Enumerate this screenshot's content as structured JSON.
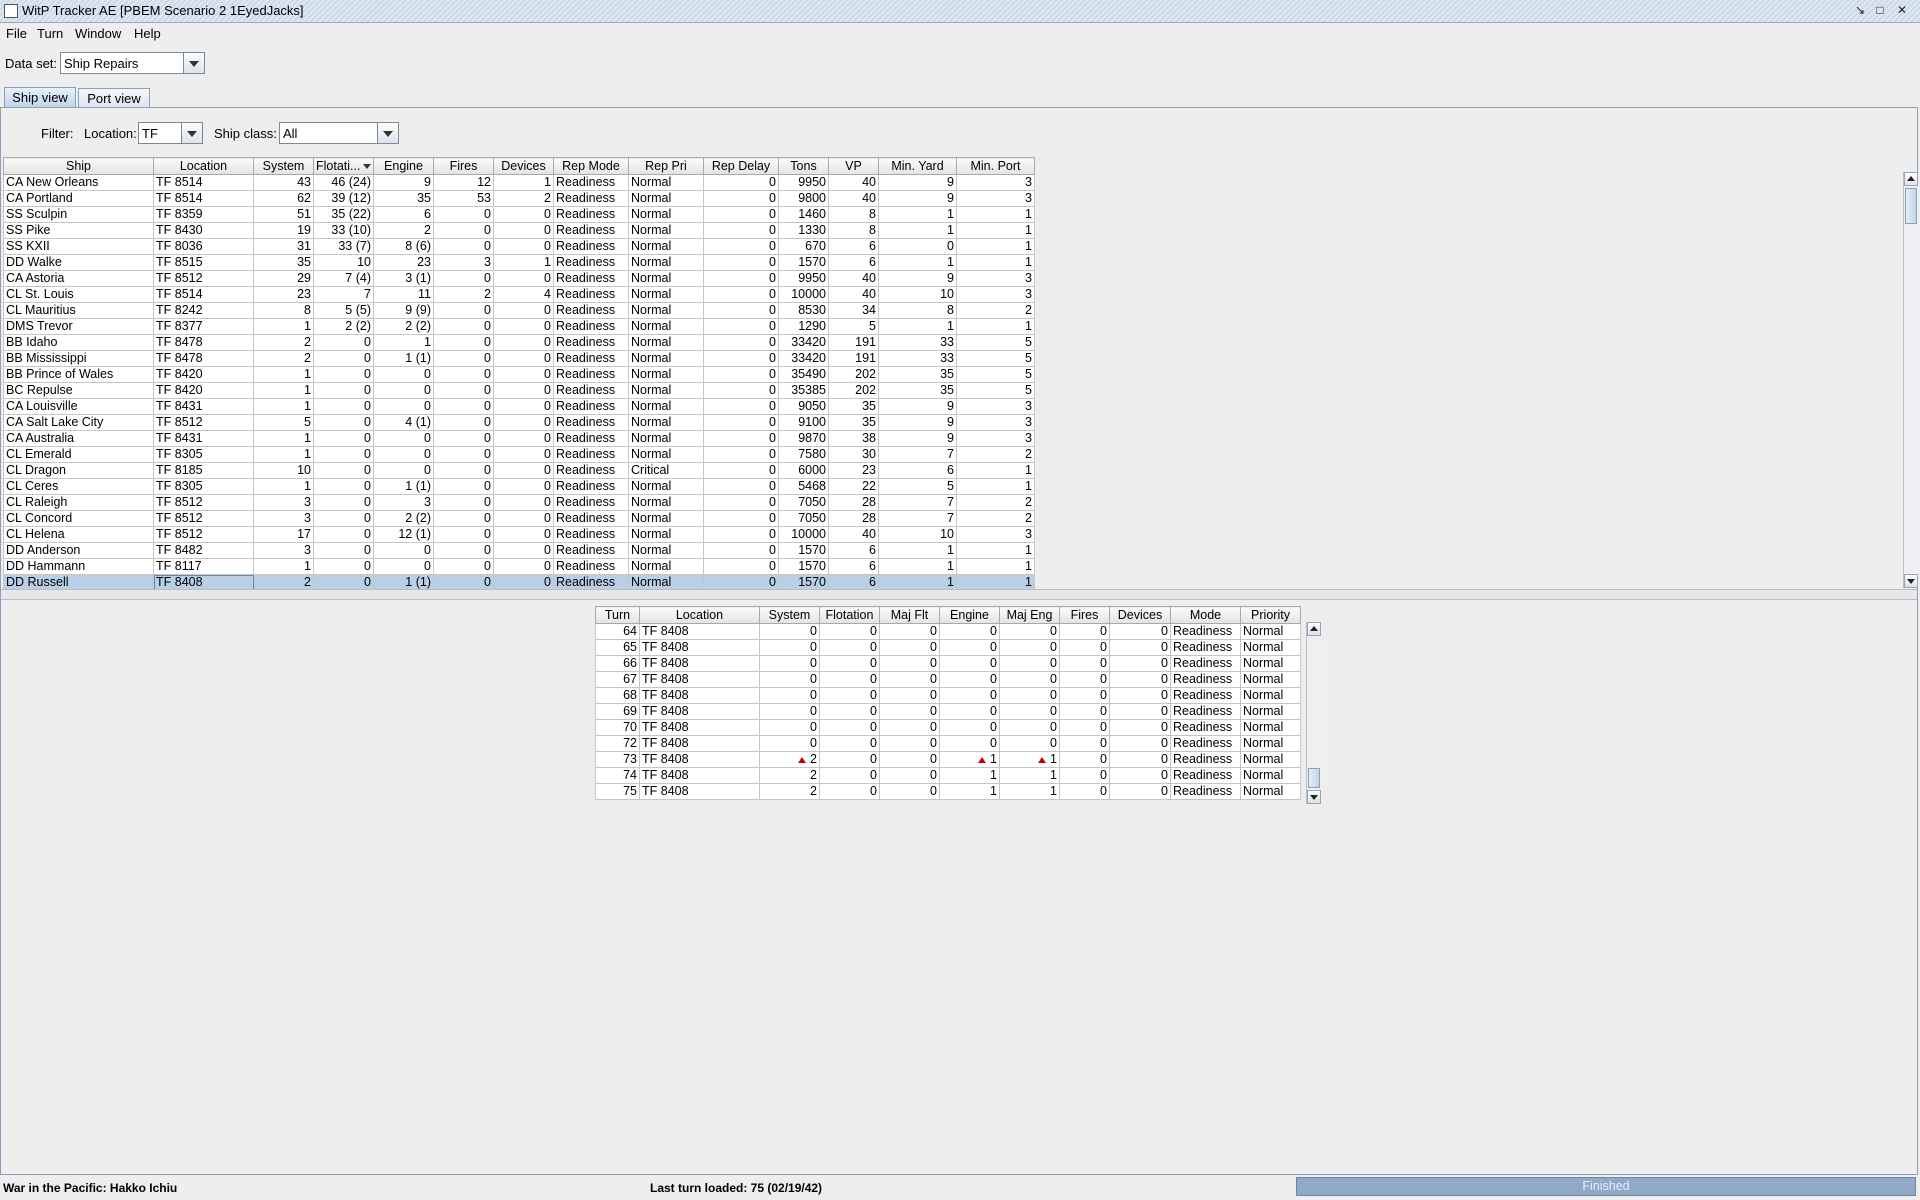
{
  "window": {
    "title": "WitP Tracker AE [PBEM Scenario 2 1EyedJacks]"
  },
  "menu": [
    "File",
    "Turn",
    "Window",
    "Help"
  ],
  "dataset": {
    "label": "Data set:",
    "value": "Ship Repairs"
  },
  "tabs": [
    "Ship view",
    "Port view"
  ],
  "filter": {
    "label": "Filter:",
    "location_label": "Location:",
    "location_value": "TF",
    "shipclass_label": "Ship class:",
    "shipclass_value": "All"
  },
  "ship_table": {
    "columns": [
      "Ship",
      "Location",
      "System",
      "Flotati...",
      "Engine",
      "Fires",
      "Devices",
      "Rep Mode",
      "Rep Pri",
      "Rep Delay",
      "Tons",
      "VP",
      "Min. Yard",
      "Min. Port"
    ],
    "rows": [
      [
        "CA New Orleans",
        "TF 8514",
        "43",
        "46 (24)",
        "9",
        "12",
        "1",
        "Readiness",
        "Normal",
        "0",
        "9950",
        "40",
        "9",
        "3"
      ],
      [
        "CA Portland",
        "TF 8514",
        "62",
        "39 (12)",
        "35",
        "53",
        "2",
        "Readiness",
        "Normal",
        "0",
        "9800",
        "40",
        "9",
        "3"
      ],
      [
        "SS Sculpin",
        "TF 8359",
        "51",
        "35 (22)",
        "6",
        "0",
        "0",
        "Readiness",
        "Normal",
        "0",
        "1460",
        "8",
        "1",
        "1"
      ],
      [
        "SS Pike",
        "TF 8430",
        "19",
        "33 (10)",
        "2",
        "0",
        "0",
        "Readiness",
        "Normal",
        "0",
        "1330",
        "8",
        "1",
        "1"
      ],
      [
        "SS KXII",
        "TF 8036",
        "31",
        "33 (7)",
        "8 (6)",
        "0",
        "0",
        "Readiness",
        "Normal",
        "0",
        "670",
        "6",
        "0",
        "1"
      ],
      [
        "DD Walke",
        "TF 8515",
        "35",
        "10",
        "23",
        "3",
        "1",
        "Readiness",
        "Normal",
        "0",
        "1570",
        "6",
        "1",
        "1"
      ],
      [
        "CA Astoria",
        "TF 8512",
        "29",
        "7 (4)",
        "3 (1)",
        "0",
        "0",
        "Readiness",
        "Normal",
        "0",
        "9950",
        "40",
        "9",
        "3"
      ],
      [
        "CL St. Louis",
        "TF 8514",
        "23",
        "7",
        "11",
        "2",
        "4",
        "Readiness",
        "Normal",
        "0",
        "10000",
        "40",
        "10",
        "3"
      ],
      [
        "CL Mauritius",
        "TF 8242",
        "8",
        "5 (5)",
        "9 (9)",
        "0",
        "0",
        "Readiness",
        "Normal",
        "0",
        "8530",
        "34",
        "8",
        "2"
      ],
      [
        "DMS Trevor",
        "TF 8377",
        "1",
        "2 (2)",
        "2 (2)",
        "0",
        "0",
        "Readiness",
        "Normal",
        "0",
        "1290",
        "5",
        "1",
        "1"
      ],
      [
        "BB Idaho",
        "TF 8478",
        "2",
        "0",
        "1",
        "0",
        "0",
        "Readiness",
        "Normal",
        "0",
        "33420",
        "191",
        "33",
        "5"
      ],
      [
        "BB Mississippi",
        "TF 8478",
        "2",
        "0",
        "1 (1)",
        "0",
        "0",
        "Readiness",
        "Normal",
        "0",
        "33420",
        "191",
        "33",
        "5"
      ],
      [
        "BB Prince of Wales",
        "TF 8420",
        "1",
        "0",
        "0",
        "0",
        "0",
        "Readiness",
        "Normal",
        "0",
        "35490",
        "202",
        "35",
        "5"
      ],
      [
        "BC Repulse",
        "TF 8420",
        "1",
        "0",
        "0",
        "0",
        "0",
        "Readiness",
        "Normal",
        "0",
        "35385",
        "202",
        "35",
        "5"
      ],
      [
        "CA Louisville",
        "TF 8431",
        "1",
        "0",
        "0",
        "0",
        "0",
        "Readiness",
        "Normal",
        "0",
        "9050",
        "35",
        "9",
        "3"
      ],
      [
        "CA Salt Lake City",
        "TF 8512",
        "5",
        "0",
        "4 (1)",
        "0",
        "0",
        "Readiness",
        "Normal",
        "0",
        "9100",
        "35",
        "9",
        "3"
      ],
      [
        "CA Australia",
        "TF 8431",
        "1",
        "0",
        "0",
        "0",
        "0",
        "Readiness",
        "Normal",
        "0",
        "9870",
        "38",
        "9",
        "3"
      ],
      [
        "CL Emerald",
        "TF 8305",
        "1",
        "0",
        "0",
        "0",
        "0",
        "Readiness",
        "Normal",
        "0",
        "7580",
        "30",
        "7",
        "2"
      ],
      [
        "CL Dragon",
        "TF 8185",
        "10",
        "0",
        "0",
        "0",
        "0",
        "Readiness",
        "Critical",
        "0",
        "6000",
        "23",
        "6",
        "1"
      ],
      [
        "CL Ceres",
        "TF 8305",
        "1",
        "0",
        "1 (1)",
        "0",
        "0",
        "Readiness",
        "Normal",
        "0",
        "5468",
        "22",
        "5",
        "1"
      ],
      [
        "CL Raleigh",
        "TF 8512",
        "3",
        "0",
        "3",
        "0",
        "0",
        "Readiness",
        "Normal",
        "0",
        "7050",
        "28",
        "7",
        "2"
      ],
      [
        "CL Concord",
        "TF 8512",
        "3",
        "0",
        "2 (2)",
        "0",
        "0",
        "Readiness",
        "Normal",
        "0",
        "7050",
        "28",
        "7",
        "2"
      ],
      [
        "CL Helena",
        "TF 8512",
        "17",
        "0",
        "12 (1)",
        "0",
        "0",
        "Readiness",
        "Normal",
        "0",
        "10000",
        "40",
        "10",
        "3"
      ],
      [
        "DD Anderson",
        "TF 8482",
        "3",
        "0",
        "0",
        "0",
        "0",
        "Readiness",
        "Normal",
        "0",
        "1570",
        "6",
        "1",
        "1"
      ],
      [
        "DD Hammann",
        "TF 8117",
        "1",
        "0",
        "0",
        "0",
        "0",
        "Readiness",
        "Normal",
        "0",
        "1570",
        "6",
        "1",
        "1"
      ],
      [
        "DD Russell",
        "TF 8408",
        "2",
        "0",
        "1 (1)",
        "0",
        "0",
        "Readiness",
        "Normal",
        "0",
        "1570",
        "6",
        "1",
        "1"
      ]
    ],
    "selected_index": 25
  },
  "history_table": {
    "columns": [
      "Turn",
      "Location",
      "System",
      "Flotation",
      "Maj Flt",
      "Engine",
      "Maj Eng",
      "Fires",
      "Devices",
      "Mode",
      "Priority"
    ],
    "rows": [
      [
        "64",
        "TF 8408",
        "0",
        "0",
        "0",
        "0",
        "0",
        "0",
        "0",
        "Readiness",
        "Normal"
      ],
      [
        "65",
        "TF 8408",
        "0",
        "0",
        "0",
        "0",
        "0",
        "0",
        "0",
        "Readiness",
        "Normal"
      ],
      [
        "66",
        "TF 8408",
        "0",
        "0",
        "0",
        "0",
        "0",
        "0",
        "0",
        "Readiness",
        "Normal"
      ],
      [
        "67",
        "TF 8408",
        "0",
        "0",
        "0",
        "0",
        "0",
        "0",
        "0",
        "Readiness",
        "Normal"
      ],
      [
        "68",
        "TF 8408",
        "0",
        "0",
        "0",
        "0",
        "0",
        "0",
        "0",
        "Readiness",
        "Normal"
      ],
      [
        "69",
        "TF 8408",
        "0",
        "0",
        "0",
        "0",
        "0",
        "0",
        "0",
        "Readiness",
        "Normal"
      ],
      [
        "70",
        "TF 8408",
        "0",
        "0",
        "0",
        "0",
        "0",
        "0",
        "0",
        "Readiness",
        "Normal"
      ],
      [
        "72",
        "TF 8408",
        "0",
        "0",
        "0",
        "0",
        "0",
        "0",
        "0",
        "Readiness",
        "Normal"
      ],
      [
        "73",
        "TF 8408",
        "2",
        "0",
        "0",
        "1",
        "1",
        "0",
        "0",
        "Readiness",
        "Normal"
      ],
      [
        "74",
        "TF 8408",
        "2",
        "0",
        "0",
        "1",
        "1",
        "0",
        "0",
        "Readiness",
        "Normal"
      ],
      [
        "75",
        "TF 8408",
        "2",
        "0",
        "0",
        "1",
        "1",
        "0",
        "0",
        "Readiness",
        "Normal"
      ]
    ],
    "increase_marks": [
      [
        8,
        2
      ],
      [
        8,
        5
      ],
      [
        8,
        6
      ]
    ]
  },
  "status": {
    "left": "War in the Pacific: Hakko Ichiu",
    "middle": "Last turn loaded: 75 (02/19/42)",
    "progress_label": "Finished",
    "progress_value": 1.0
  }
}
